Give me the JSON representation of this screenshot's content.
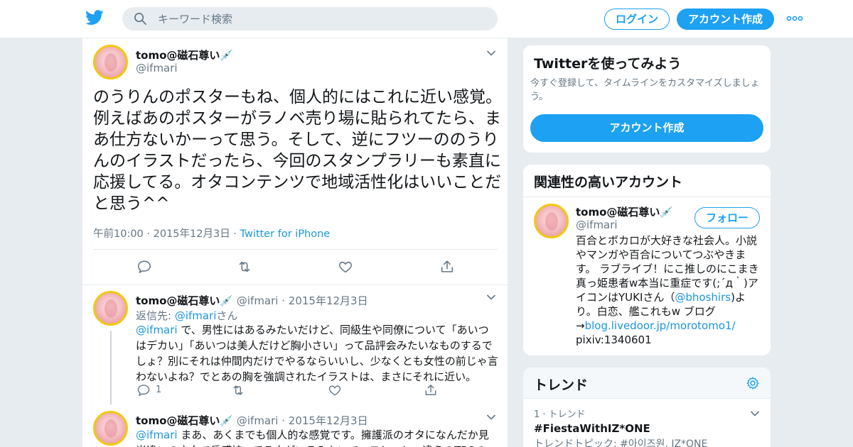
{
  "header": {
    "search_placeholder": "キーワード検索",
    "login": "ログイン",
    "signup": "アカウント作成"
  },
  "tweet": {
    "name": "tomo@磁石尊い💉",
    "handle": "@ifmari",
    "text": "のうりんのポスターもね、個人的にはこれに近い感覚。例えばあのポスターがラノベ売り場に貼られてたら、まあ仕方ないかーって思う。そして、逆にフツーののうりんのイラストだったら、今回のスタンプラリーも素直に応援してる。オタコンテンツで地域活性化はいいことだと思う^^",
    "time": "午前10:00 · 2015年12月3日",
    "sep": " · ",
    "via": "Twitter for iPhone"
  },
  "replies": [
    {
      "name": "tomo@磁石尊い💉",
      "handle": "@ifmari",
      "date": "· 2015年12月3日",
      "reply_label": "返信先: ",
      "reply_handle": "@ifmari",
      "reply_suffix": "さん",
      "mention": "@ifmari",
      "text": " で、男性にはあるみたいだけど、同級生や同僚について「あいつはデカい」「あいつは美人だけど胸小さい」って品評会みたいなものするでしょ？別にそれは仲間内だけでやるならいいし、少なくとも女性の前じゃ言わないよね？でとあの胸を強調されたイラストは、まさにそれに近い。",
      "reply_count": "1"
    },
    {
      "name": "tomo@磁石尊い💉",
      "handle": "@ifmari",
      "date": "· 2015年12月3日",
      "mention": "@ifmari",
      "text": " まあ、あくまでも個人的な感覚です。擁護派のオタになんだか見当違いの方向で反感持ってる人がいるみたいで、モヤっと。違うのTPOの"
    }
  ],
  "try_card": {
    "title": "Twitterを使ってみよう",
    "desc": "今すぐ登録して、タイムラインをカスタマイズしましょう。",
    "button": "アカウント作成"
  },
  "related": {
    "title": "関連性の高いアカウント",
    "name": "tomo@磁石尊い💉",
    "handle": "@ifmari",
    "follow": "フォロー",
    "bio_1": "百合とボカロが大好きな社会人。小説やマンガや百合についてつぶやきます。 ラブライブ！にこ推しのにこまき真っ姫患者w本当に重症です(;´д｀)アイコンはYUKIさん（",
    "bio_link": "@bhoshirs",
    "bio_2": ")より。白恋、艦これもw ブログ→",
    "bio_url": "blog.livedoor.jp/morotomo1/",
    "bio_3": "pixiv:1340601"
  },
  "trends": {
    "title": "トレンド",
    "items": [
      {
        "rank": "1 · トレンド",
        "name": "#FiestaWithIZ*ONE",
        "related": "トレンドトピック: #아이즈원, IZ*ONE"
      }
    ]
  },
  "colors": {
    "accent": "#1da1f2",
    "link": "#1b95e0",
    "background": "#e6ecf0",
    "text": "#14171a",
    "muted": "#657786"
  }
}
